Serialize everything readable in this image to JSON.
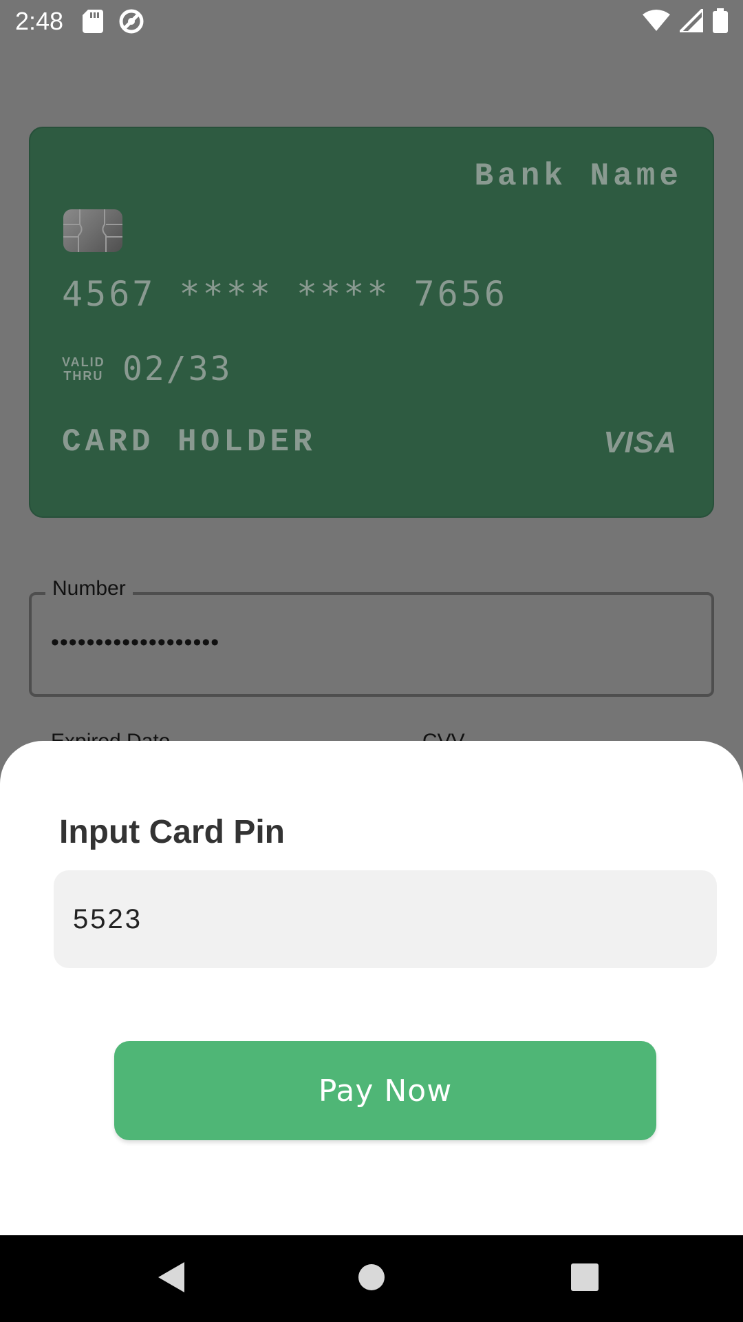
{
  "status_bar": {
    "time": "2:48",
    "left_icons": [
      "sd-card-icon",
      "vpn-key-icon"
    ],
    "right_icons": [
      "wifi-icon",
      "signal-icon",
      "battery-icon"
    ]
  },
  "card": {
    "bank_name": "Bank Name",
    "number": "4567 **** **** 7656",
    "valid_label_line1": "VALID",
    "valid_label_line2": "THRU",
    "expiry": "02/33",
    "holder": "CARD HOLDER",
    "brand": "VISA",
    "color": "#2e5b41"
  },
  "form": {
    "number_label": "Number",
    "number_value": "•••••••••••••••••••",
    "expired_label": "Expired Date",
    "cvv_label": "CVV"
  },
  "sheet": {
    "title": "Input Card Pin",
    "pin_value": "5523",
    "pay_button_label": "Pay Now",
    "accent": "#4fb676"
  },
  "nav_bar": {
    "buttons": [
      "back-icon",
      "home-icon",
      "recents-icon"
    ]
  }
}
